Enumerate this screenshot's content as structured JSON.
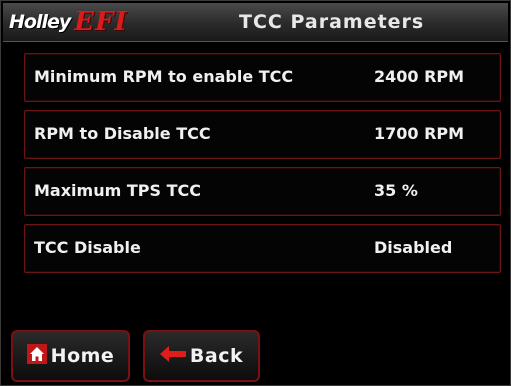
{
  "header": {
    "logo_holley": "Holley",
    "logo_efi": "EFI",
    "title": "TCC Parameters"
  },
  "parameters": [
    {
      "label": "Minimum RPM to enable TCC",
      "value": "2400 RPM"
    },
    {
      "label": "RPM to Disable TCC",
      "value": "1700 RPM"
    },
    {
      "label": "Maximum TPS TCC",
      "value": "35 %"
    },
    {
      "label": "TCC Disable",
      "value": "Disabled"
    }
  ],
  "buttons": {
    "home_label": "Home",
    "back_label": "Back",
    "home_icon": "home-icon",
    "back_icon": "arrow-left-icon"
  },
  "colors": {
    "accent_red": "#d81c1c",
    "border_red": "#7a1010",
    "background": "#000000"
  }
}
